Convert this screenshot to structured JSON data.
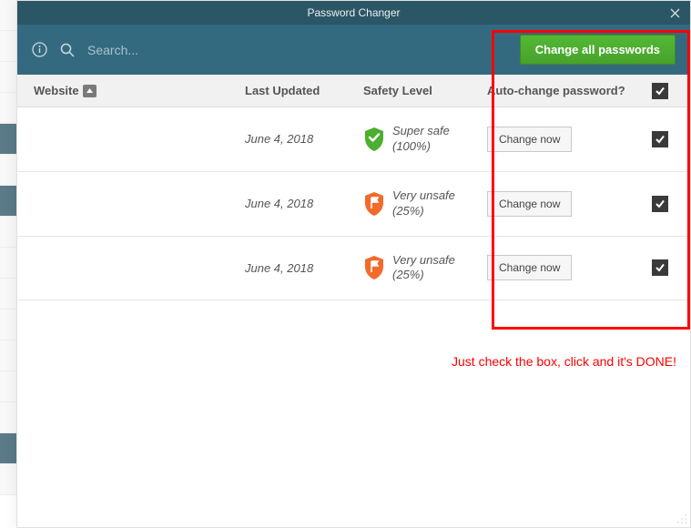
{
  "window": {
    "title": "Password Changer"
  },
  "toolbar": {
    "search_placeholder": "Search...",
    "change_all_label": "Change all passwords"
  },
  "columns": {
    "website": "Website",
    "last_updated": "Last Updated",
    "safety_level": "Safety Level",
    "auto_change": "Auto-change password?"
  },
  "rows": [
    {
      "last_updated": "June 4, 2018",
      "safety_label": "Super safe",
      "safety_pct": "(100%)",
      "safety_color": "#4caf2f",
      "safety_icon": "check",
      "change_label": "Change now",
      "checked": true
    },
    {
      "last_updated": "June 4, 2018",
      "safety_label": "Very unsafe",
      "safety_pct": "(25%)",
      "safety_color": "#f26b2a",
      "safety_icon": "flag",
      "change_label": "Change now",
      "checked": true
    },
    {
      "last_updated": "June 4, 2018",
      "safety_label": "Very unsafe",
      "safety_pct": "(25%)",
      "safety_color": "#f26b2a",
      "safety_icon": "flag",
      "change_label": "Change now",
      "checked": true
    }
  ],
  "annotation": {
    "text": "Just check the box, click and it's DONE!"
  }
}
